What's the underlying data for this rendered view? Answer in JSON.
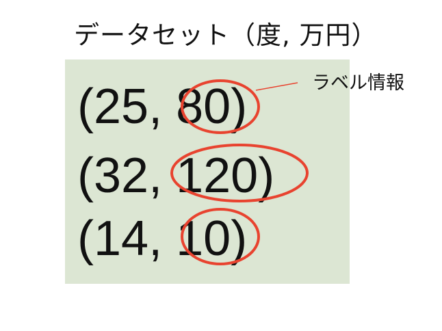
{
  "title": "データセット（度, 万円）",
  "label_note": "ラベル情報",
  "colors": {
    "panel": "#dce6d3",
    "highlight": "#e8432f",
    "text": "#111111"
  },
  "rows": [
    {
      "open": "(",
      "x": "25",
      "sep": ", ",
      "y": "80",
      "close": ")"
    },
    {
      "open": "(",
      "x": "32",
      "sep": ", ",
      "y": "120",
      "close": ")"
    },
    {
      "open": "(",
      "x": "14",
      "sep": ", ",
      "y": "10",
      "close": ")"
    }
  ]
}
